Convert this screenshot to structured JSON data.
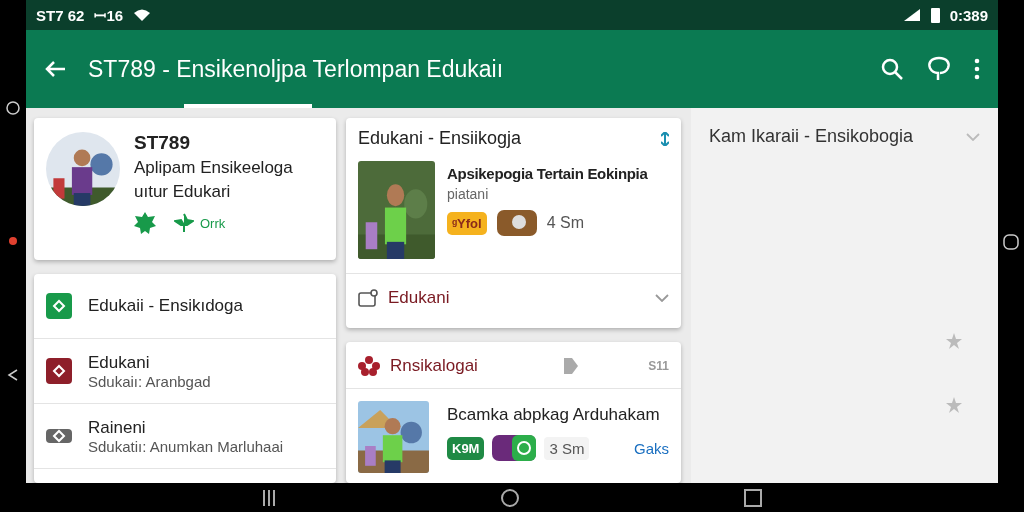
{
  "status_bar": {
    "left": [
      "ST7 62",
      "ꟷ16"
    ],
    "time": "0:389"
  },
  "app_bar": {
    "title": "ST789 - Ensikenoljpa Terlompan Edukaiı"
  },
  "profile": {
    "name": "ST789",
    "line_1": "Aplipam Ensikeeloga",
    "line_2": "uıtur Edukari",
    "action": "Orrk"
  },
  "menu": [
    {
      "kind": "green",
      "title": "Edukaii - Ensikıdoga"
    },
    {
      "kind": "red",
      "title": "Edukani",
      "subtitle": "Sdukaiı: Aranbgad"
    },
    {
      "kind": "gray",
      "title": "Raineni",
      "subtitle": "Sdukatiı: Anumkan Marluhaai"
    }
  ],
  "feed_card": {
    "heading": "Edukani - Ensiikogja",
    "article_title": "Apsikepogia Tertain Eokinpia",
    "article_subtitle": "piatani",
    "badge": "ᵍYfol",
    "reading_time": "4 Sm",
    "footer": "Edukani"
  },
  "feed_card_2": {
    "heading": "Rnsikalogai",
    "count": "S11",
    "article_title": "Bcamka abpkag Arduhakam",
    "badge": "K9M",
    "reading_time": "3 Sm",
    "link": "Gaks"
  },
  "side_panel": {
    "title": "Kam Ikaraii - Ensikobogia"
  }
}
